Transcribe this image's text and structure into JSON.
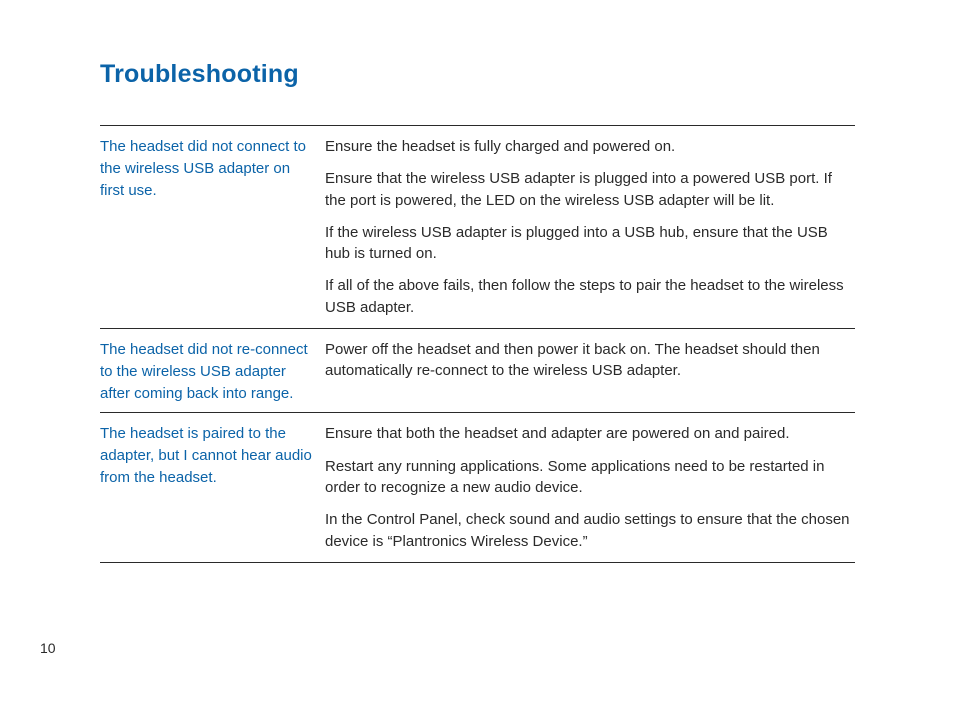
{
  "page": {
    "title": "Troubleshooting",
    "pageNumber": "10"
  },
  "rows": [
    {
      "problem": "The headset did not connect to the wireless USB adapter on first use.",
      "solutions": [
        "Ensure the headset is fully charged and powered on.",
        "Ensure that the wireless USB adapter is plugged into a powered USB port. If the port is powered, the LED on the wireless USB adapter will be lit.",
        "If the wireless USB adapter is plugged into a USB hub, ensure that the USB hub is turned on.",
        "If all of the above fails, then follow the steps to pair the headset to the wireless USB adapter."
      ]
    },
    {
      "problem": "The headset did not re-connect to the wireless USB adapter after coming back into range.",
      "solutions": [
        "Power off the headset and then power it back on.  The headset should then automatically re-connect to the wireless USB adapter."
      ]
    },
    {
      "problem": "The headset is paired to the adapter, but I cannot hear audio from the headset.",
      "solutions": [
        "Ensure that both the headset and adapter are powered on and paired.",
        "Restart any running applications. Some applications need to be restarted in order to recognize a new audio device.",
        "In the Control Panel, check sound and audio settings to ensure that the chosen device is “Plantronics Wireless Device.”"
      ]
    }
  ]
}
